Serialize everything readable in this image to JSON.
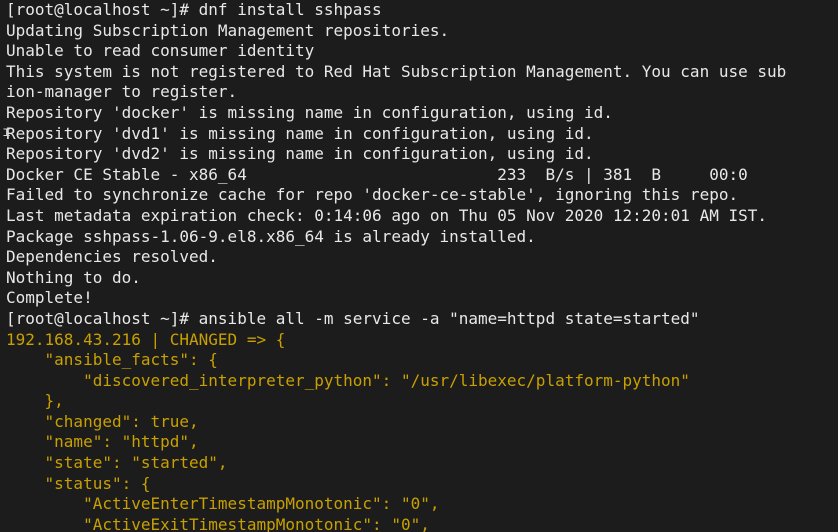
{
  "theme": {
    "background": "#1c1c1c",
    "default_text": "#e8e8e8",
    "ansible_text": "#c8a000"
  },
  "terminal": {
    "lines": [
      {
        "text": "[root@localhost ~]# dnf install sshpass",
        "style": "default"
      },
      {
        "text": "Updating Subscription Management repositories.",
        "style": "default"
      },
      {
        "text": "Unable to read consumer identity",
        "style": "default"
      },
      {
        "text": "This system is not registered to Red Hat Subscription Management. You can use sub",
        "style": "default"
      },
      {
        "text": "ion-manager to register.",
        "style": "default"
      },
      {
        "text": "Repository 'docker' is missing name in configuration, using id.",
        "style": "default"
      },
      {
        "text": "Repository 'dvd1' is missing name in configuration, using id.",
        "style": "default"
      },
      {
        "text": "Repository 'dvd2' is missing name in configuration, using id.",
        "style": "default"
      },
      {
        "text": "Docker CE Stable - x86_64                          233  B/s | 381  B     00:0",
        "style": "default"
      },
      {
        "text": "Failed to synchronize cache for repo 'docker-ce-stable', ignoring this repo.",
        "style": "default"
      },
      {
        "text": "Last metadata expiration check: 0:14:06 ago on Thu 05 Nov 2020 12:20:01 AM IST.",
        "style": "default"
      },
      {
        "text": "Package sshpass-1.06-9.el8.x86_64 is already installed.",
        "style": "default"
      },
      {
        "text": "Dependencies resolved.",
        "style": "default"
      },
      {
        "text": "Nothing to do.",
        "style": "default"
      },
      {
        "text": "Complete!",
        "style": "default"
      },
      {
        "text": "[root@localhost ~]# ansible all -m service -a \"name=httpd state=started\"",
        "style": "default"
      },
      {
        "text": "192.168.43.216 | CHANGED => {",
        "style": "ansible"
      },
      {
        "text": "    \"ansible_facts\": {",
        "style": "ansible"
      },
      {
        "text": "        \"discovered_interpreter_python\": \"/usr/libexec/platform-python\"",
        "style": "ansible"
      },
      {
        "text": "    },",
        "style": "ansible"
      },
      {
        "text": "    \"changed\": true,",
        "style": "ansible"
      },
      {
        "text": "    \"name\": \"httpd\",",
        "style": "ansible"
      },
      {
        "text": "    \"state\": \"started\",",
        "style": "ansible"
      },
      {
        "text": "    \"status\": {",
        "style": "ansible"
      },
      {
        "text": "        \"ActiveEnterTimestampMonotonic\": \"0\",",
        "style": "ansible"
      },
      {
        "text": "        \"ActiveExitTimestampMonotonic\": \"0\",",
        "style": "ansible"
      }
    ]
  }
}
